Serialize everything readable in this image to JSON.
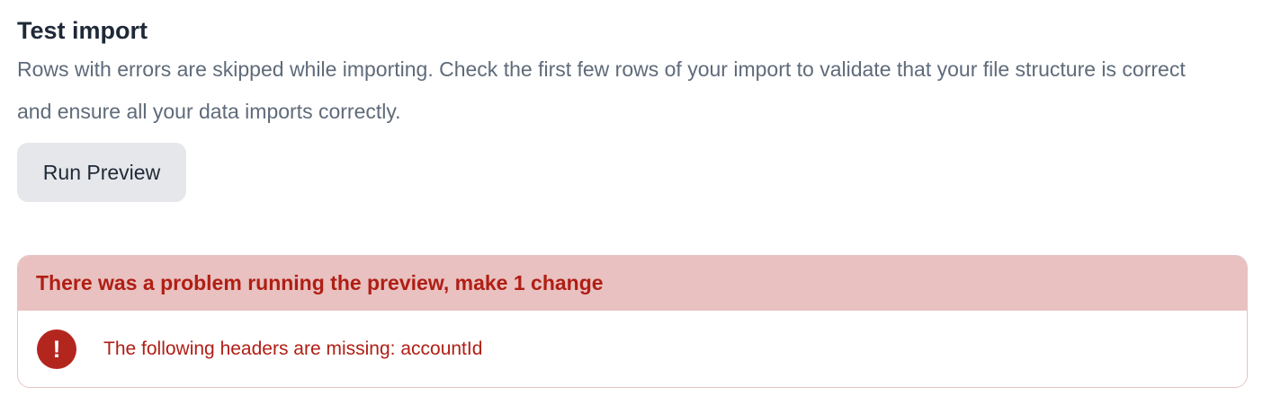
{
  "section": {
    "title": "Test import",
    "description": "Rows with errors are skipped while importing. Check the first few rows of your import to validate that your file structure is correct and ensure all your data imports correctly.",
    "run_button_label": "Run Preview"
  },
  "alert": {
    "header": "There was a problem running the preview, make 1 change",
    "icon": "exclamation-circle-icon",
    "icon_glyph": "!",
    "message": "The following headers are missing: accountId"
  },
  "colors": {
    "error_red": "#b01e14",
    "alert_header_bg": "#e8c1c0",
    "button_bg": "#e5e7eb"
  }
}
